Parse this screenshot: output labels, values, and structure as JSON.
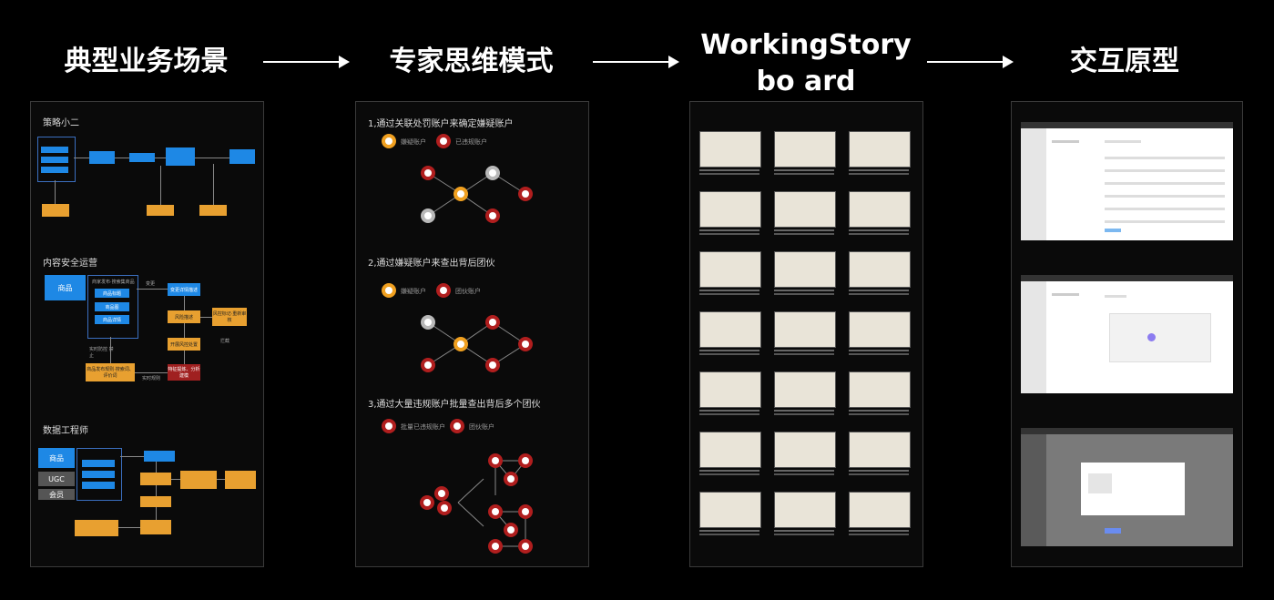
{
  "stages": [
    {
      "title": "典型业务场景"
    },
    {
      "title": "专家思维模式"
    },
    {
      "title": "WorkingStorybo ard"
    },
    {
      "title": "交互原型"
    }
  ],
  "scenarios": {
    "sections": [
      {
        "label": "策略小二"
      },
      {
        "label": "内容安全运营"
      },
      {
        "label": "数据工程师"
      }
    ],
    "content_ops": {
      "goods": "商品",
      "publish_text": "商家发布·搜索集商品",
      "items": [
        "商品标题",
        "商品图",
        "商品详情"
      ],
      "change": "变更",
      "review": "变更详情描述",
      "risk": "风险描述",
      "risk_action": "风控标记·重新审核",
      "risk_control": "开展风控处置",
      "punish": "特征提炼、分析建模",
      "feedback": "商品发布规则·搜索词、评价词",
      "realtime": "实时防控 禁止",
      "blocked": "拦截",
      "model_rules": "实时规则"
    },
    "data_eng": {
      "goods": "商品",
      "ugc": "UGC",
      "member": "会员"
    }
  },
  "expert": {
    "steps": [
      {
        "title": "1,通过关联处罚账户来确定嫌疑账户",
        "legend_a": "嫌疑账户",
        "legend_b": "已违规账户"
      },
      {
        "title": "2,通过嫌疑账户来查出背后团伙",
        "legend_a": "嫌疑账户",
        "legend_b": "团伙账户"
      },
      {
        "title": "3,通过大量违规账户批量查出背后多个团伙",
        "legend_a": "批量已违规账户",
        "legend_b": "团伙账户"
      }
    ]
  }
}
